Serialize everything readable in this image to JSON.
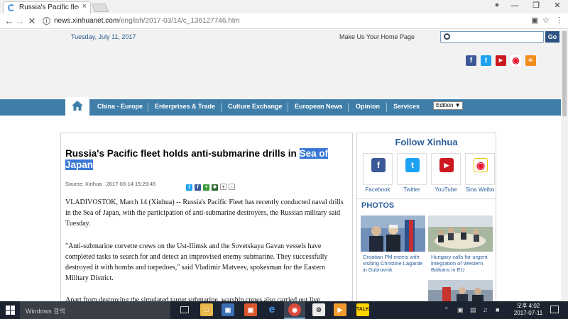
{
  "browser": {
    "tab_title": "Russia's Pacific fleet holds",
    "tab_close": "×",
    "url_host": "news.xinhuanet.com",
    "url_path": "/english/2017-03/14/c_136127746.htm"
  },
  "header": {
    "date": "Tuesday, July 11, 2017",
    "homepage_link": "Make Us Your Home Page",
    "search_placeholder": "",
    "go_label": "Go"
  },
  "nav": {
    "items": [
      "China - Europe",
      "Enterprises & Trade",
      "Culture Exchange",
      "European News",
      "Opinion",
      "Services"
    ],
    "edition": "Edition ▼"
  },
  "article": {
    "headline_main": "Russia's Pacific fleet holds anti-submarine drills in ",
    "headline_highlight_1": "Sea of",
    "headline_highlight_2": "Japan",
    "source": "Source: Xinhua",
    "timestamp": "2017-03-14 15:29:45",
    "paragraphs": [
      "VLADIVOSTOK, March 14 (Xinhua) -- Russia's Pacific Fleet has recently conducted naval drills in the Sea of Japan, with the participation of anti-submarine destroyers, the Russian military said Tuesday.",
      "\"Anti-submarine corvette crews on the Ust-Ilimsk and the Sovetskaya Gavan vessels have completed tasks to search for and detect an improvised enemy submarine. They successfully destroyed it with bombs and torpedoes,\" said Vladimir Matveev, spokesman for the Eastern Military District.",
      "Apart from destroying the simulated target submarine, warship crews also carried out live"
    ]
  },
  "follow": {
    "title": "Follow Xinhua",
    "items": [
      {
        "label": "Facebook",
        "icon": "facebook-icon",
        "color": "#3b5998",
        "glyph": "f"
      },
      {
        "label": "Twitter",
        "icon": "twitter-icon",
        "color": "#1da1f2",
        "glyph": "t"
      },
      {
        "label": "YouTube",
        "icon": "youtube-icon",
        "color": "#cc181e",
        "glyph": "▶"
      },
      {
        "label": "Sina Weibo",
        "icon": "weibo-icon",
        "color": "#e6162d",
        "glyph": "w"
      }
    ]
  },
  "photos": {
    "title": "PHOTOS",
    "items": [
      {
        "caption": "Croatian PM meets with visiting Christine Lagarde in Dubrovnik"
      },
      {
        "caption": "Hungary calls for urgent integration of Western Balkans in EU"
      }
    ]
  },
  "taskbar": {
    "search_text": "Windows 검색",
    "time": "오후 4:02",
    "date": "2017-07-11"
  },
  "colors": {
    "nav_blue": "#3f7ea8",
    "link_blue": "#2b5e9a",
    "highlight": "#3a78d6"
  }
}
